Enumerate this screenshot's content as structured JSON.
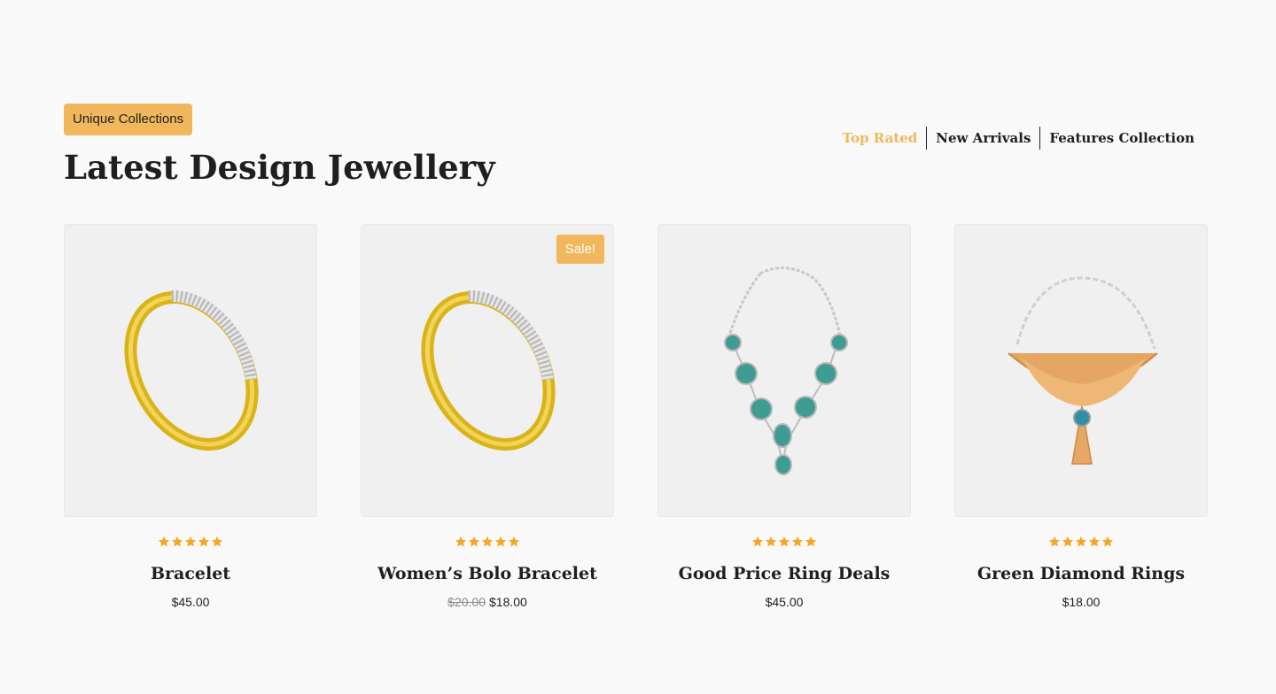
{
  "header": {
    "badge": "Unique Collections",
    "title": "Latest Design Jewellery"
  },
  "tabs": [
    {
      "label": "Top Rated",
      "active": true
    },
    {
      "label": "New Arrivals",
      "active": false
    },
    {
      "label": "Features Collection",
      "active": false
    }
  ],
  "products": [
    {
      "name": "Bracelet",
      "price": "$45.00",
      "old_price": "",
      "sale_badge": "",
      "rating": 5,
      "image_icon": "gold-bangle-icon"
    },
    {
      "name": "Women’s Bolo Bracelet",
      "price": "$18.00",
      "old_price": "$20.00",
      "sale_badge": "Sale!",
      "rating": 5,
      "image_icon": "gold-bangle-icon"
    },
    {
      "name": "Good Price Ring Deals",
      "price": "$45.00",
      "old_price": "",
      "sale_badge": "",
      "rating": 5,
      "image_icon": "gemstone-necklace-icon"
    },
    {
      "name": "Green Diamond Rings",
      "price": "$18.00",
      "old_price": "",
      "sale_badge": "",
      "rating": 5,
      "image_icon": "gold-pendant-necklace-icon"
    }
  ],
  "colors": {
    "accent": "#f0b75c",
    "star": "#f5a623",
    "text": "#1f1f1f"
  }
}
